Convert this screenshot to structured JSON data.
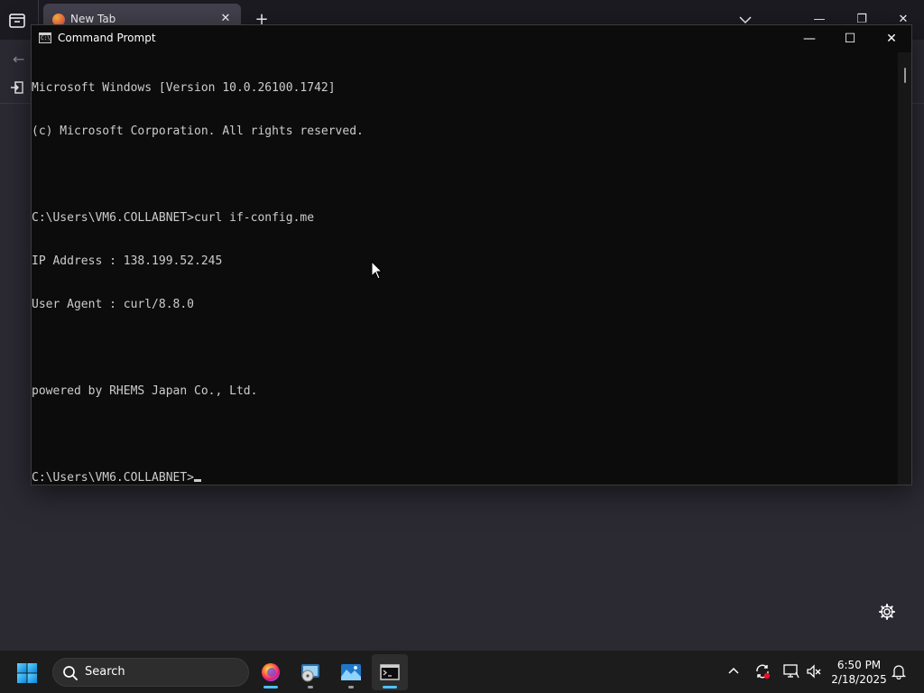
{
  "firefox": {
    "tab_title": "New Tab",
    "tab_close_glyph": "✕",
    "new_tab_glyph": "+",
    "back_glyph": "←",
    "minimize_glyph": "—",
    "restore_glyph": "❐",
    "close_glyph": "✕"
  },
  "cmd": {
    "title": "Command Prompt",
    "icon_text": "C:\\",
    "minimize_glyph": "—",
    "maximize_glyph": "☐",
    "close_glyph": "✕",
    "lines": [
      "Microsoft Windows [Version 10.0.26100.1742]",
      "(c) Microsoft Corporation. All rights reserved.",
      "",
      "C:\\Users\\VM6.COLLABNET>curl if-config.me",
      "IP Address : 138.199.52.245",
      "User Agent : curl/8.8.0",
      "",
      "powered by RHEMS Japan Co., Ltd.",
      ""
    ],
    "prompt": "C:\\Users\\VM6.COLLABNET>"
  },
  "taskbar": {
    "search_label": "Search",
    "apps": [
      {
        "name": "Firefox",
        "icon": "firefox-icon"
      },
      {
        "name": "Disc Image Tool",
        "icon": "disc-app-icon"
      },
      {
        "name": "Photos",
        "icon": "photos-icon"
      },
      {
        "name": "Command Prompt",
        "icon": "terminal-icon"
      }
    ],
    "clock": {
      "time": "6:50 PM",
      "date": "2/18/2025"
    }
  },
  "colors": {
    "console_bg": "#0c0c0c",
    "console_fg": "#cccccc",
    "taskbar_bg": "#1c1c1c",
    "accent": "#4cc2ff"
  }
}
